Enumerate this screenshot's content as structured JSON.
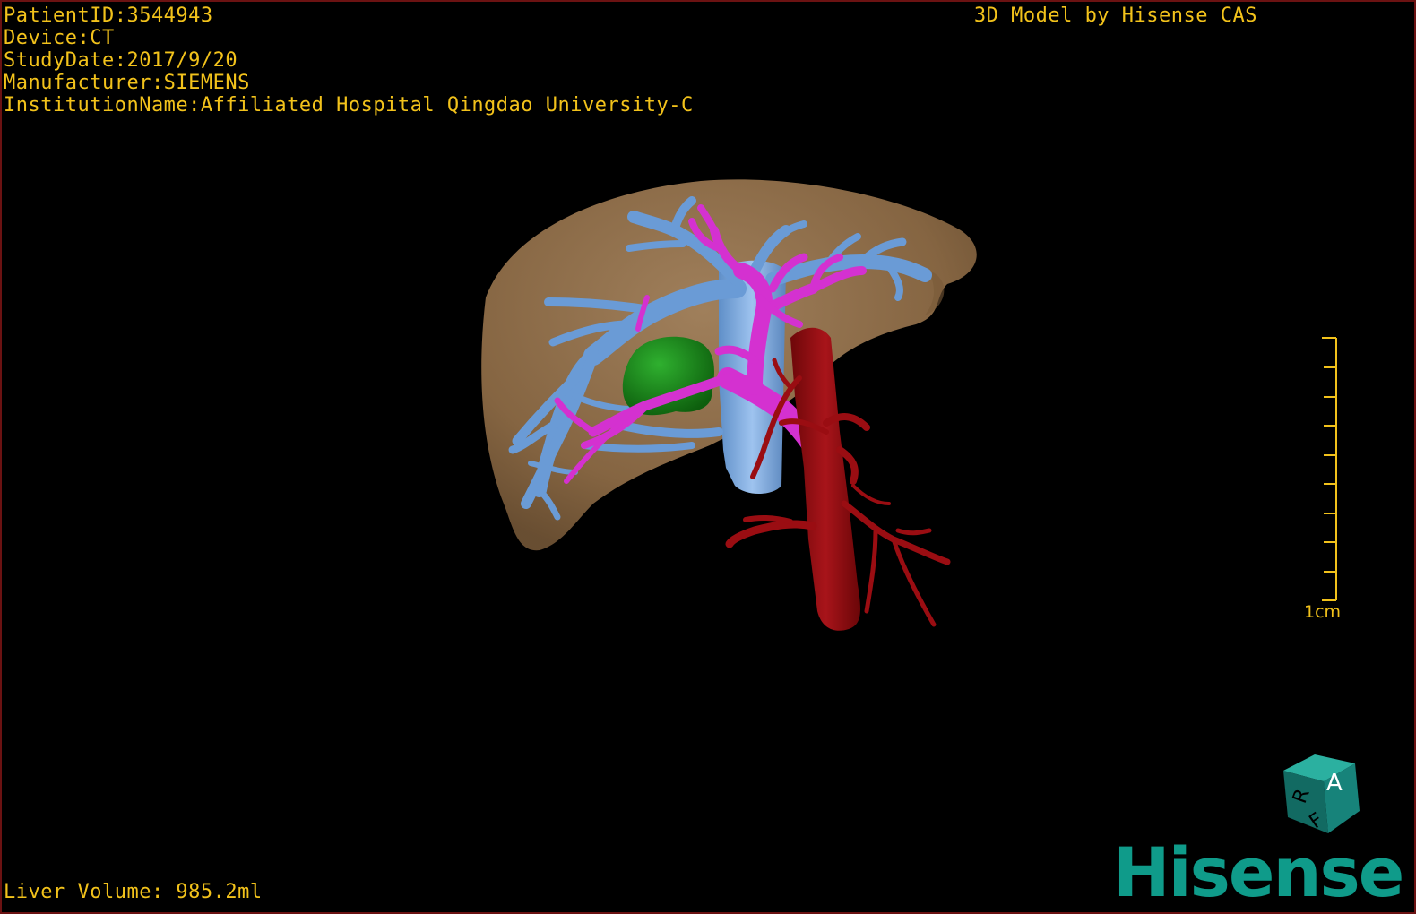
{
  "dicom_info": {
    "patient_id": "PatientID:3544943",
    "device": "Device:CT",
    "study_date": "StudyDate:2017/9/20",
    "manufacturer": "Manufacturer:SIEMENS",
    "institution": "InstitutionName:Affiliated Hospital Qingdao University-C"
  },
  "model_credit": "3D Model by Hisense CAS",
  "liver_volume": "Liver Volume: 985.2ml",
  "scale": {
    "label": "1cm"
  },
  "orientation_cube": {
    "face_top": "A",
    "face_left": "R",
    "face_bottom": "F"
  },
  "brand": {
    "logo_text": "Hisense"
  },
  "colors": {
    "overlay_text": "#f2c21b",
    "liver": "#8c6a45",
    "hepatic_vein": "#6a9bd6",
    "portal_vein": "#d431d0",
    "artery": "#9a0d12",
    "lesion": "#1b8a1b",
    "brand": "#0f9b8a"
  }
}
